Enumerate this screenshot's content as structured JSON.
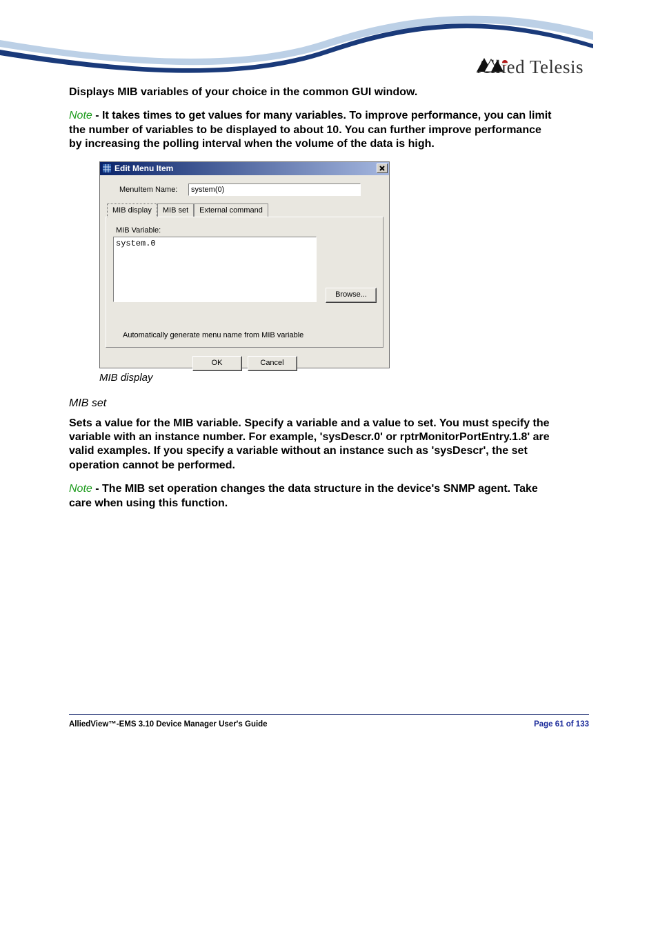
{
  "brand": {
    "name": "Allied Telesis"
  },
  "content": {
    "intro": "Displays MIB variables of your choice in the common GUI window.",
    "note1_prefix": "Note",
    "note1_body": " - It takes times to get values for many variables. To improve performance, you can limit the number of variables to be displayed to about 10. You can further improve performance by increasing the polling interval when the volume of the data is high.",
    "caption1": "MIB display",
    "heading2": "MIB set",
    "mibset_body": "Sets a value for the MIB variable. Specify a variable and a value to set. You must specify the variable with an instance number. For example, 'sysDescr.0' or rptrMonitorPortEntry.1.8' are valid examples. If you specify a variable without an instance such as 'sysDescr', the set operation cannot be performed.",
    "note2_prefix": "Note",
    "note2_body": " - The MIB set operation changes the data structure in the device's SNMP agent. Take care when using this function."
  },
  "dialog": {
    "title": "Edit Menu Item",
    "close": "✕",
    "menuitem_label": "MenuItem Name:",
    "menuitem_value": "system(0)",
    "tabs": {
      "t1": "MIB display",
      "t2": "MIB set",
      "t3": "External command"
    },
    "mib_label": "MIB Variable:",
    "mib_value": "system.0",
    "browse": "Browse...",
    "autogen": "Automatically generate menu name from MIB variable",
    "ok": "OK",
    "cancel": "Cancel"
  },
  "footer": {
    "left": "AlliedView™-EMS 3.10 Device Manager User's Guide",
    "right": "Page 61 of 133"
  }
}
